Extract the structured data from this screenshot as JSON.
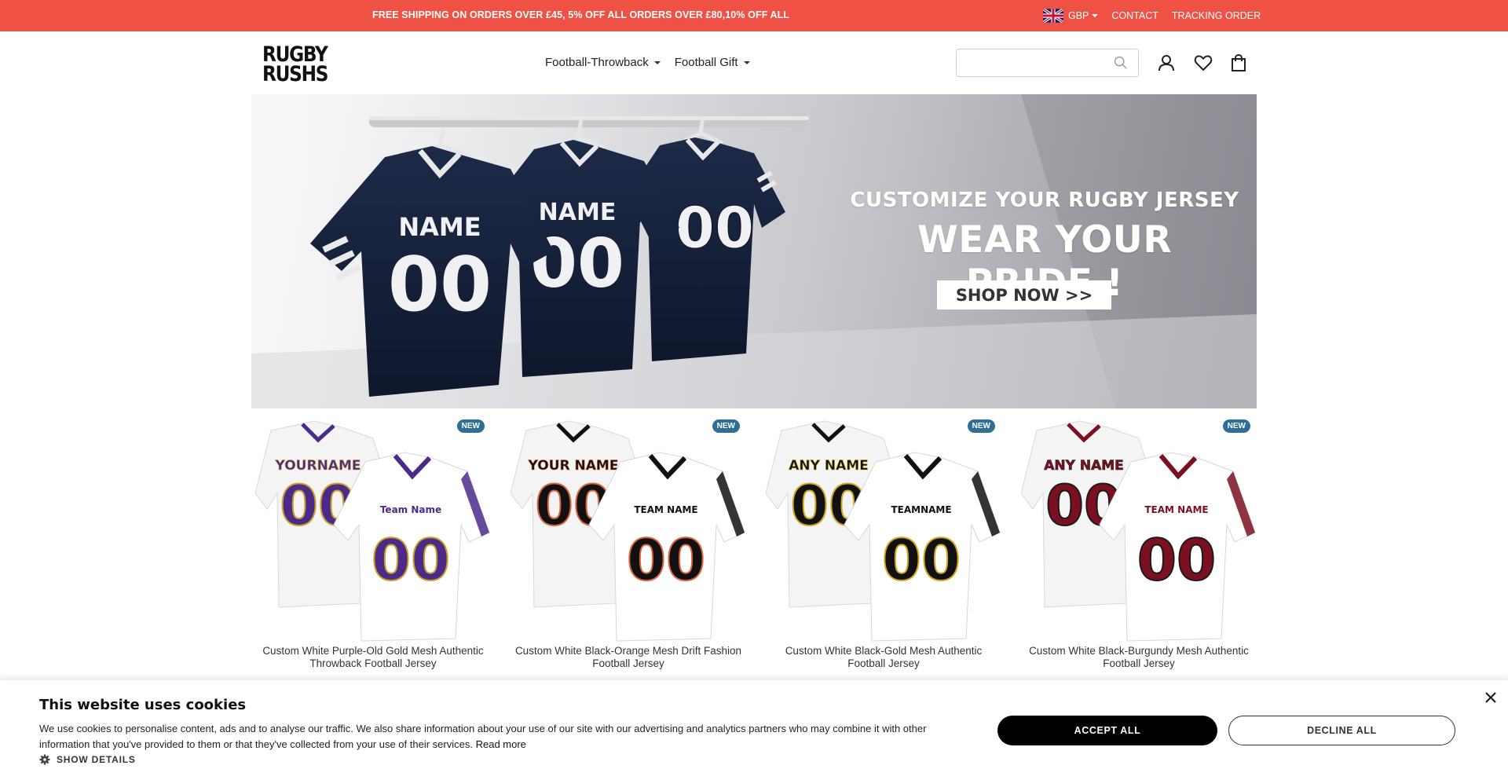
{
  "topbar": {
    "promo": "FREE SHIPPING ON ORDERS OVER £45, 5% OFF ALL ORDERS OVER £80,10% OFF ALL",
    "currency": "GBP",
    "contact": "CONTACT",
    "tracking": "TRACKING ORDER",
    "bg_color": "#ef5244"
  },
  "header": {
    "logo_line1": "RUGBY",
    "logo_line2": "RUSHS",
    "nav": [
      {
        "label": "Football-Throwback"
      },
      {
        "label": "Football Gift"
      }
    ],
    "search_placeholder": "",
    "icons": [
      "account-icon",
      "wishlist-heart-icon",
      "cart-bag-icon"
    ]
  },
  "hero": {
    "subtitle": "CUSTOMIZE YOUR RUGBY JERSEY",
    "title": "WEAR YOUR PRIDE !",
    "button": "SHOP NOW >>",
    "jersey_text": {
      "name": "NAME",
      "number": "00"
    }
  },
  "products": [
    {
      "badge": "NEW",
      "title": "Custom White Purple-Old Gold Mesh Authentic Throwback Football Jersey",
      "jersey_name": "YOURNAME",
      "jersey_team": "Team Name",
      "trim": "#4b2a8a",
      "accent": "#c9a227"
    },
    {
      "badge": "NEW",
      "title": "Custom White Black-Orange Mesh Drift Fashion Football Jersey",
      "jersey_name": "YOUR NAME",
      "jersey_team": "TEAM NAME",
      "trim": "#111111",
      "accent": "#d9643a"
    },
    {
      "badge": "NEW",
      "title": "Custom White Black-Gold Mesh Authentic Football Jersey",
      "jersey_name": "ANY NAME",
      "jersey_team": "TEAMNAME",
      "trim": "#111111",
      "accent": "#d4a81e"
    },
    {
      "badge": "NEW",
      "title": "Custom White Black-Burgundy Mesh Authentic Football Jersey",
      "jersey_name": "ANY NAME",
      "jersey_team": "TEAM NAME",
      "trim": "#7a1020",
      "accent": "#1a1a1a"
    }
  ],
  "cookie": {
    "title": "This website uses cookies",
    "body": "We use cookies to personalise content, ads and to analyse our traffic. We also share information about your use of our site with our advertising and analytics partners who may combine it with other information that you've provided to them or that they've collected from your use of their services.",
    "read_more": "Read more",
    "show_details": "SHOW DETAILS",
    "accept": "ACCEPT ALL",
    "decline": "DECLINE ALL"
  }
}
